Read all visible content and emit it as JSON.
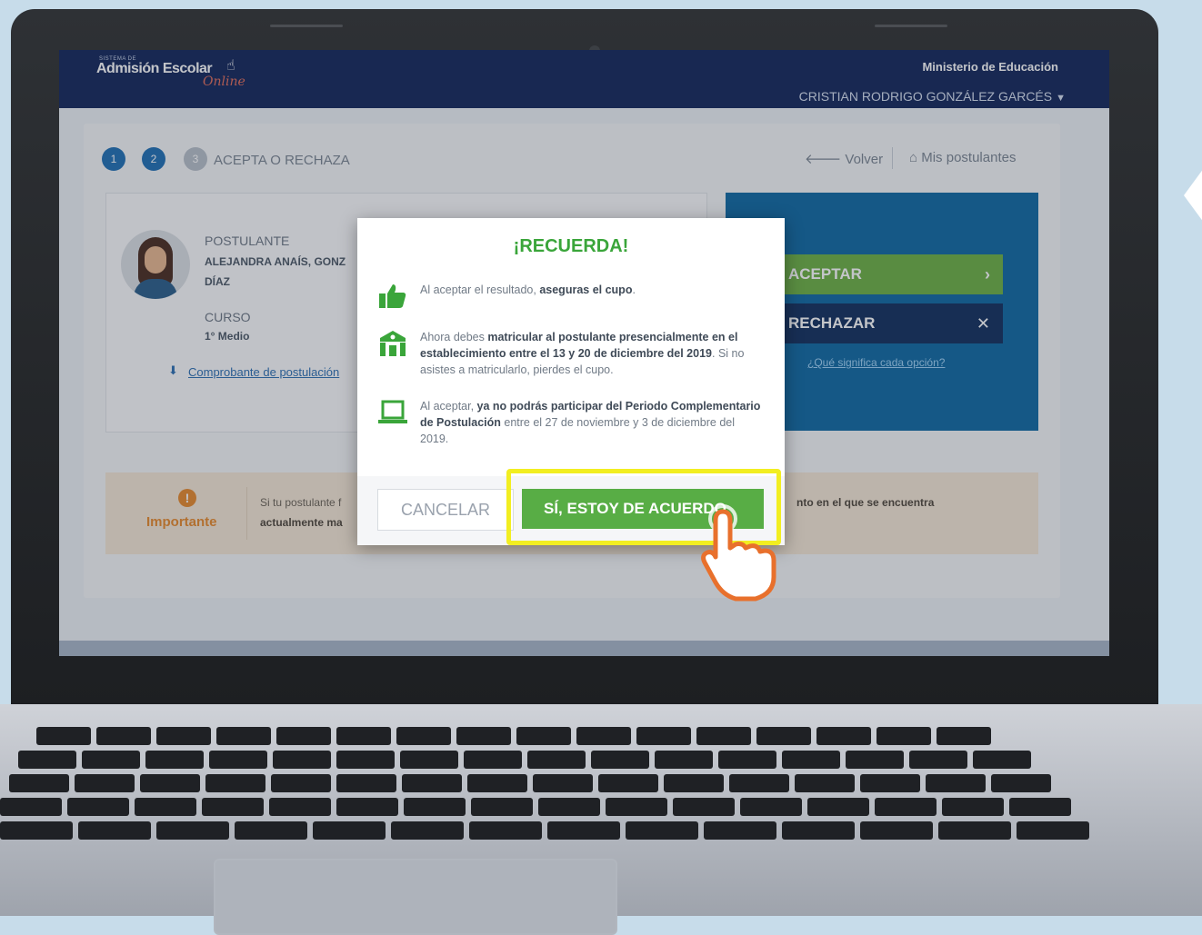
{
  "header": {
    "brand_small": "SISTEMA DE",
    "brand_name": "Admisión Escolar",
    "brand_script": "Online",
    "ministry": "Ministerio de Educación",
    "user_name": "CRISTIAN RODRIGO GONZÁLEZ GARCÉS"
  },
  "steps": {
    "step1": "1",
    "step2": "2",
    "step3": "3",
    "current_label": "ACEPTA O RECHAZA"
  },
  "nav": {
    "back": "Volver",
    "my_applicants": "Mis postulantes"
  },
  "applicant": {
    "applicant_label": "POSTULANTE",
    "applicant_name_line1": "ALEJANDRA ANAÍS, GONZ",
    "applicant_name_line2": "DÍAZ",
    "course_label": "CURSO",
    "course_value": "1° Medio",
    "receipt_link": "Comprobante de postulación"
  },
  "decision": {
    "accept": "ACEPTAR",
    "reject": "RECHAZAR",
    "what_means": "¿Qué significa cada opción?"
  },
  "important": {
    "label": "Importante",
    "text1": "Si tu postulante f",
    "text2": "actualmente ma",
    "text3": "nto en el que se encuentra"
  },
  "modal": {
    "title": "¡RECUERDA!",
    "tip1_pre": "Al aceptar el resultado, ",
    "tip1_bold": "aseguras el cupo",
    "tip1_post": ".",
    "tip2_pre": "Ahora debes ",
    "tip2_bold": "matricular al postulante presencialmente en el establecimiento entre el 13 y 20 de diciembre del 2019",
    "tip2_post": ". Si no asistes a matricularlo, pierdes el cupo.",
    "tip3_pre": "Al aceptar, ",
    "tip3_bold": "ya no podrás participar del Periodo Complementario de Postulación",
    "tip3_post": " entre el 27 de noviembre y 3 de diciembre del 2019.",
    "cancel": "CANCELAR",
    "agree": "SÍ, ESTOY DE ACUERDO"
  },
  "colors": {
    "navbar": "#13265a",
    "accept_green": "#6cb043",
    "modal_title_green": "#3aa53a",
    "highlight_yellow": "#f2ee21",
    "decision_blue": "#0f69a3"
  },
  "icons": {
    "thumbs_up": "thumbs-up-icon",
    "school": "school-icon",
    "laptop": "laptop-icon",
    "pointer_hand": "pointing-hand-icon"
  }
}
